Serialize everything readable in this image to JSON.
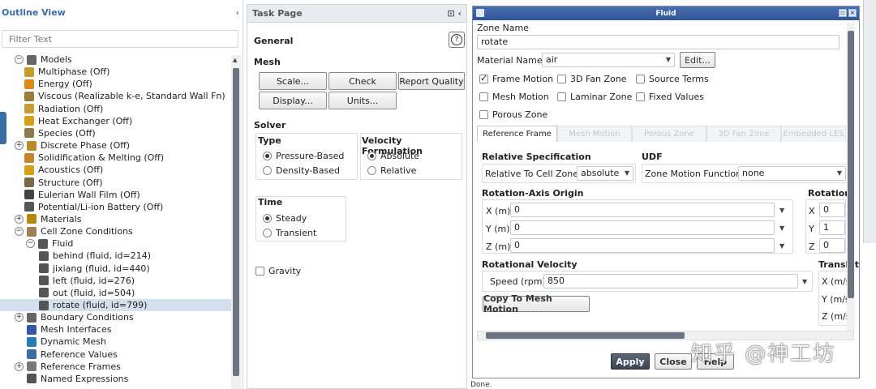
{
  "outline": {
    "title": "Outline View",
    "collapse": "‹",
    "filter_placeholder": "Filter Text",
    "tree": [
      {
        "label": "Models",
        "exp": "−",
        "icon": "models-icon",
        "color": "#666"
      },
      {
        "label": "Multiphase (Off)",
        "icon": "multiphase-icon",
        "color": "#c59a2a"
      },
      {
        "label": "Energy (Off)",
        "icon": "energy-icon",
        "color": "#d98a1a"
      },
      {
        "label": "Viscous (Realizable k-e, Standard Wall Fn)",
        "icon": "viscous-icon",
        "color": "#9b7b3a"
      },
      {
        "label": "Radiation (Off)",
        "icon": "radiation-icon",
        "color": "#c79a3a"
      },
      {
        "label": "Heat Exchanger (Off)",
        "icon": "heat-exchanger-icon",
        "color": "#d4a017"
      },
      {
        "label": "Species (Off)",
        "icon": "species-icon",
        "color": "#8a7a4a"
      },
      {
        "label": "Discrete Phase (Off)",
        "exp": "+",
        "icon": "discrete-phase-icon",
        "color": "#b98a2a"
      },
      {
        "label": "Solidification & Melting (Off)",
        "icon": "solidification-icon",
        "color": "#c8822a"
      },
      {
        "label": "Acoustics (Off)",
        "icon": "acoustics-icon",
        "color": "#d4a017"
      },
      {
        "label": "Structure (Off)",
        "icon": "structure-icon",
        "color": "#7a6a4a"
      },
      {
        "label": "Eulerian Wall Film (Off)",
        "icon": "wall-film-icon",
        "color": "#444"
      },
      {
        "label": "Potential/Li-ion Battery (Off)",
        "icon": "battery-icon",
        "color": "#555"
      },
      {
        "label": "Materials",
        "exp": "+",
        "icon": "materials-icon",
        "color": "#b8860b"
      },
      {
        "label": "Cell Zone Conditions",
        "exp": "−",
        "icon": "cell-zone-icon",
        "color": "#a08050"
      },
      {
        "label": "Fluid",
        "exp": "−",
        "icon": "fluid-zone-icon",
        "color": "#555"
      },
      {
        "label": "behind (fluid, id=214)",
        "icon": "zone-icon",
        "color": "#555"
      },
      {
        "label": "jixiang (fluid, id=440)",
        "icon": "zone-icon",
        "color": "#555"
      },
      {
        "label": "left (fluid, id=276)",
        "icon": "zone-icon",
        "color": "#555"
      },
      {
        "label": "out (fluid, id=504)",
        "icon": "zone-icon",
        "color": "#555"
      },
      {
        "label": "rotate (fluid, id=799)",
        "icon": "zone-icon",
        "color": "#555"
      },
      {
        "label": "Boundary Conditions",
        "exp": "+",
        "icon": "boundary-icon",
        "color": "#666"
      },
      {
        "label": "Mesh Interfaces",
        "icon": "mesh-interfaces-icon",
        "color": "#3355aa"
      },
      {
        "label": "Dynamic Mesh",
        "icon": "dynamic-mesh-icon",
        "color": "#2a7ab8"
      },
      {
        "label": "Reference Values",
        "icon": "reference-values-icon",
        "color": "#3a6ea5"
      },
      {
        "label": "Reference Frames",
        "exp": "+",
        "icon": "reference-frames-icon",
        "color": "#777"
      },
      {
        "label": "Named Expressions",
        "icon": "expressions-icon",
        "color": "#555"
      }
    ]
  },
  "task": {
    "title": "Task Page",
    "pin": "⊡ ‹",
    "section": "General",
    "help": "?",
    "mesh_label": "Mesh",
    "mesh_buttons": [
      "Scale...",
      "Check",
      "Report Quality",
      "Display...",
      "Units..."
    ],
    "solver_label": "Solver",
    "type_label": "Type",
    "type_options": [
      "Pressure-Based",
      "Density-Based"
    ],
    "velocity_label": "Velocity Formulation",
    "velocity_options": [
      "Absolute",
      "Relative"
    ],
    "time_label": "Time",
    "time_options": [
      "Steady",
      "Transient"
    ],
    "gravity": "Gravity"
  },
  "dialog": {
    "title": "Fluid",
    "zone_name_label": "Zone Name",
    "zone_name": "rotate",
    "material_label": "Material Name",
    "material": "air",
    "edit": "Edit...",
    "checks": [
      {
        "label": "Frame Motion",
        "on": true
      },
      {
        "label": "3D Fan Zone",
        "on": false
      },
      {
        "label": "Source Terms",
        "on": false
      },
      {
        "label": "Mesh Motion",
        "on": false
      },
      {
        "label": "Laminar Zone",
        "on": false
      },
      {
        "label": "Fixed Values",
        "on": false
      },
      {
        "label": "Porous Zone",
        "on": false
      }
    ],
    "tabs": [
      "Reference Frame",
      "Mesh Motion",
      "Porous Zone",
      "3D Fan Zone",
      "Embedded LES"
    ],
    "rel_spec_label": "Relative Specification",
    "rel_to_label": "Relative To Cell Zone",
    "rel_to_value": "absolute",
    "udf_label": "UDF",
    "zone_motion_label": "Zone Motion Function",
    "zone_motion_value": "none",
    "origin_label": "Rotation-Axis Origin",
    "origin": [
      {
        "label": "X (m)",
        "value": "0"
      },
      {
        "label": "Y (m)",
        "value": "0"
      },
      {
        "label": "Z (m)",
        "value": "0"
      }
    ],
    "axis_label": "Rotation-A",
    "axis": [
      {
        "label": "X",
        "value": "0"
      },
      {
        "label": "Y",
        "value": "1"
      },
      {
        "label": "Z",
        "value": "0"
      }
    ],
    "rot_vel_label": "Rotational Velocity",
    "speed_label": "Speed (rpm)",
    "speed_value": "850",
    "copy_btn": "Copy To Mesh Motion",
    "trans_label": "Translat",
    "trans": [
      "X (m/s)",
      "Y (m/s)",
      "Z (m/s)"
    ],
    "apply": "Apply",
    "close": "Close",
    "help": "Help"
  },
  "watermark": "知乎 @神工坊",
  "status": "Done."
}
